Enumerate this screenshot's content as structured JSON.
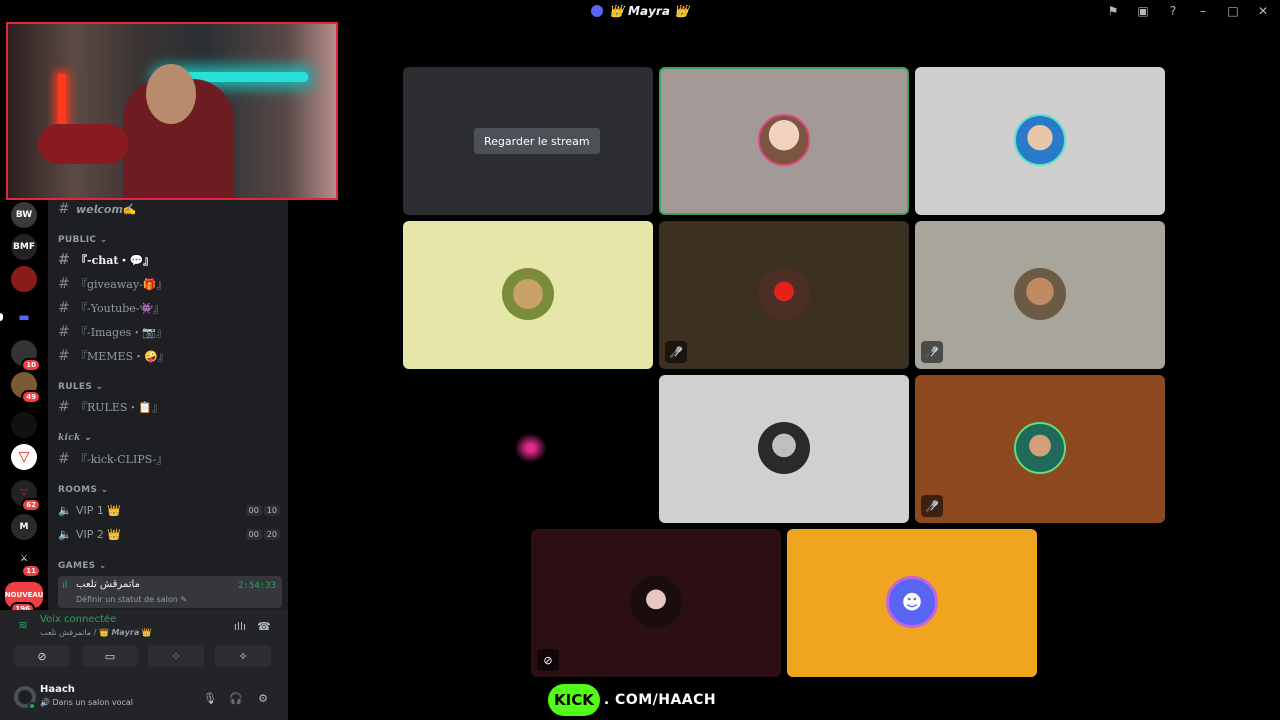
{
  "window": {
    "title": "👑 𝙈𝙖𝙮𝙧𝙖 👑"
  },
  "channels": {
    "welcome": "𝙬𝙚𝙡𝙘𝙤𝙢✍",
    "public_category": "PUBLIC ⌄",
    "public": [
      "『-chat・💬』",
      "『giveaway-🎁』",
      "『-Youtube-👾』",
      "『-Images・📷』",
      "『MEMES・🤪』"
    ],
    "rules_category": "RULES ⌄",
    "rules": [
      "『RULES・📋』"
    ],
    "kick_category": "kick ⌄",
    "kick": [
      "『-kick-CLIPS-』"
    ],
    "rooms_category": "ROOMS ⌄",
    "rooms": [
      {
        "label": "VIP 1 👑",
        "count": "00",
        "limit": "10"
      },
      {
        "label": "VIP 2 👑",
        "count": "00",
        "limit": "20"
      }
    ],
    "games_category": "GAMES ⌄",
    "active_voice": {
      "name": "ماتمرقش تلعب",
      "time": "2:54:33",
      "status": "Définir un statut de salon ✎"
    }
  },
  "servers": {
    "badges": [
      "10",
      "49",
      "62",
      "11",
      "196"
    ],
    "new_label": "NOUVEAU"
  },
  "voice_panel": {
    "status": "Voix connectée",
    "subtitle": "ماتمرقش تلعب / 👑 𝙈𝙖𝙮𝙧𝙖 👑"
  },
  "user": {
    "name": "Haach",
    "state": "🔊 Dans un salon vocal"
  },
  "stream": {
    "watch_label": "Regarder le stream"
  },
  "banner": {
    "logo": "KICK",
    "url": ". COM/HAACH"
  },
  "colors": {
    "accent_green": "#23a55a",
    "speaking_border": "#3ba55c",
    "kick_green": "#53fc18"
  }
}
